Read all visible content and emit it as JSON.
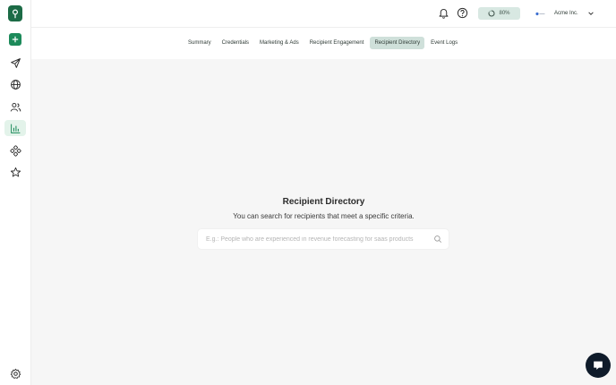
{
  "sidebar": {
    "items": [
      {
        "icon": "send-icon"
      },
      {
        "icon": "globe-icon"
      },
      {
        "icon": "users-icon"
      },
      {
        "icon": "bar-chart-icon",
        "active": true
      },
      {
        "icon": "integrations-icon"
      },
      {
        "icon": "star-icon"
      }
    ],
    "settings_icon": "gear-icon"
  },
  "header": {
    "progress_label": "80%",
    "progress_value": 0.8,
    "account_name": "Acme Inc."
  },
  "tabs": [
    {
      "label": "Summary"
    },
    {
      "label": "Credentials"
    },
    {
      "label": "Marketing & Ads"
    },
    {
      "label": "Recipient Engagement"
    },
    {
      "label": "Recipient Directory",
      "active": true
    },
    {
      "label": "Event Logs"
    }
  ],
  "main": {
    "title": "Recipient Directory",
    "subtitle": "You can search for recipients that meet a specific criteria.",
    "search_placeholder": "E.g.: People who are experienced in revenue forecasting for saas products"
  },
  "colors": {
    "brand": "#1c8a5a",
    "active_tab": "#cfe0da",
    "background": "#f6f6f6"
  }
}
